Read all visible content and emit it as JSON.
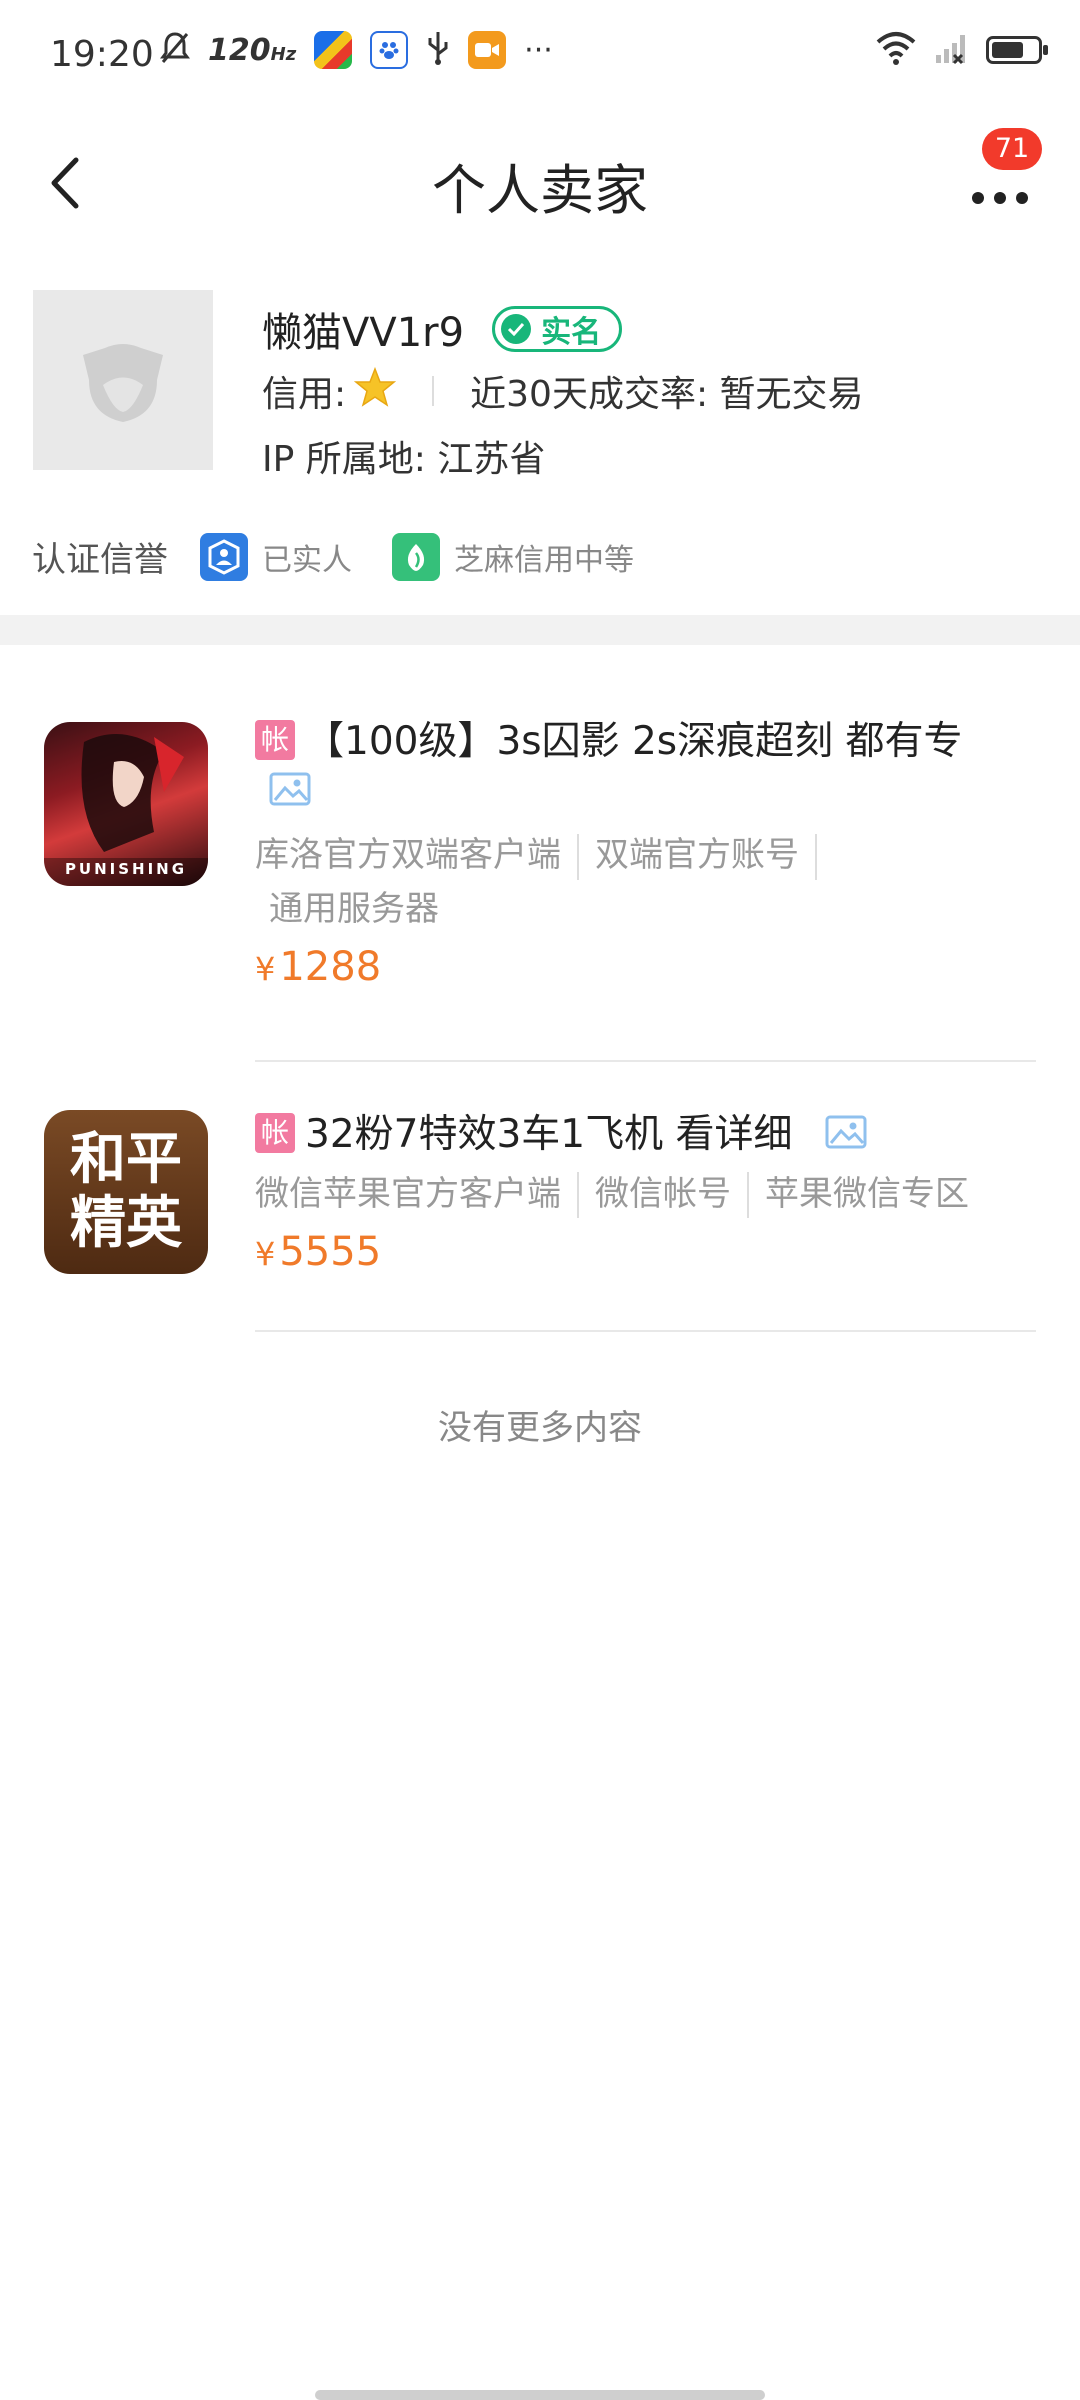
{
  "status_bar": {
    "time": "19:20",
    "refresh_rate": "120",
    "refresh_unit": "Hz",
    "more": "···",
    "battery_level": 0.7
  },
  "nav": {
    "title": "个人卖家",
    "badge_count": "71"
  },
  "seller": {
    "name": "懒猫VV1r9",
    "verified_label": "实名",
    "credit_label": "信用:",
    "trade_rate": "近30天成交率: 暂无交易",
    "ip_location": "IP 所属地: 江苏省",
    "cert_title": "认证信誉",
    "cert_items": [
      {
        "label": "已实人",
        "icon": "person-shield-icon",
        "color": "#2f7de1"
      },
      {
        "label": "芝麻信用中等",
        "icon": "sesame-leaf-icon",
        "color": "#35c07a"
      }
    ]
  },
  "listings": [
    {
      "tag": "帐",
      "title": "【100级】3s囚影 2s深痕超刻 都有专",
      "icon_text": "PUNISHING",
      "meta": [
        "库洛官方双端客户端",
        "双端官方账号",
        "通用服务器"
      ],
      "currency": "¥",
      "price": "1288"
    },
    {
      "tag": "帐",
      "title": "32粉7特效3车1飞机 看详细",
      "icon_text_top": "和平",
      "icon_text_bottom": "精英",
      "meta": [
        "微信苹果官方客户端",
        "微信帐号",
        "苹果微信专区"
      ],
      "currency": "¥",
      "price": "5555"
    }
  ],
  "footer": {
    "no_more": "没有更多内容"
  },
  "colors": {
    "accent_price": "#f07a2a",
    "verified_green": "#18b67a",
    "badge_red": "#f23a2b",
    "tag_pink": "#f27aa0"
  }
}
